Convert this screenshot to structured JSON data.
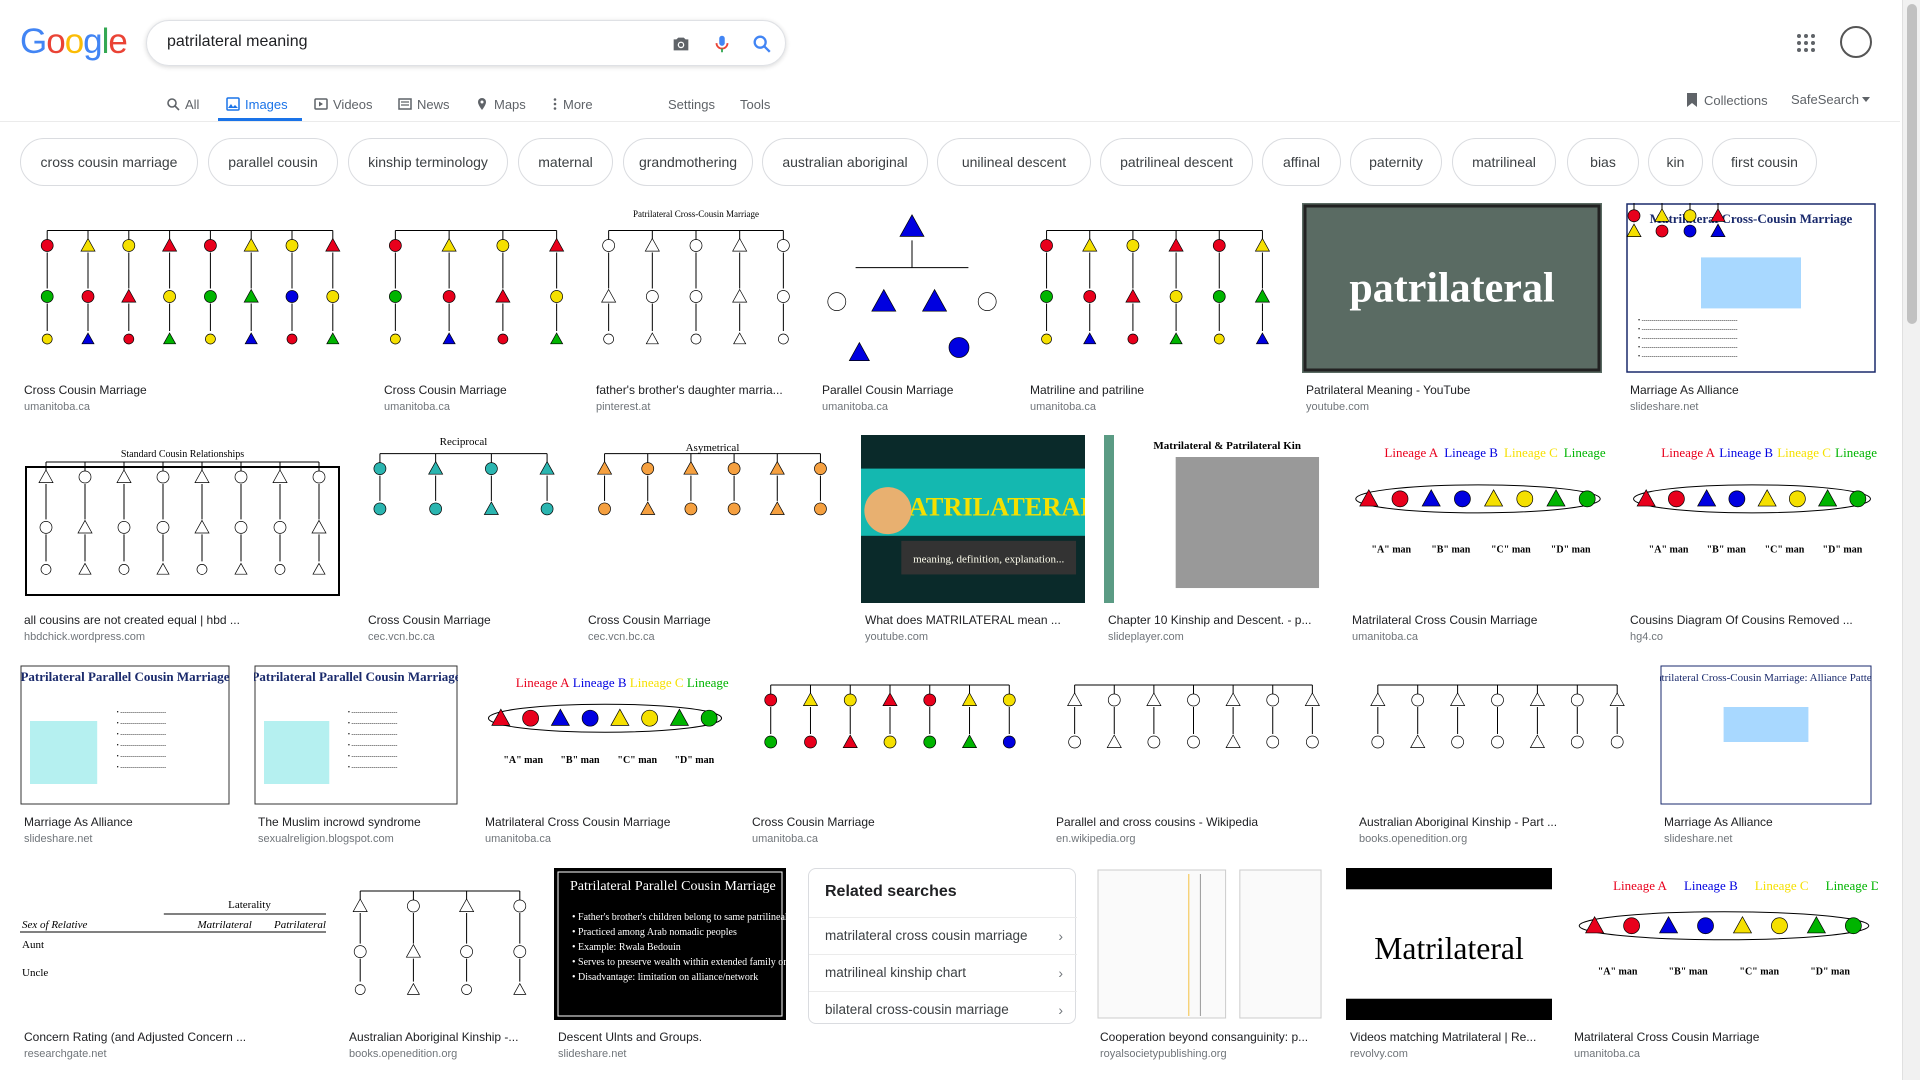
{
  "logo": {
    "letters": [
      "G",
      "o",
      "o",
      "g",
      "l",
      "e"
    ],
    "colors": [
      "#4285f4",
      "#ea4335",
      "#fbbc05",
      "#4285f4",
      "#34a853",
      "#ea4335"
    ]
  },
  "search": {
    "query": "patrilateral meaning"
  },
  "nav": {
    "tabs": [
      {
        "label": "All",
        "icon": "search-icon"
      },
      {
        "label": "Images",
        "icon": "image-icon"
      },
      {
        "label": "Videos",
        "icon": "play-icon"
      },
      {
        "label": "News",
        "icon": "news-icon"
      },
      {
        "label": "Maps",
        "icon": "map-pin-icon"
      },
      {
        "label": "More",
        "icon": "more-vert-icon"
      }
    ],
    "settings": "Settings",
    "tools": "Tools",
    "collections": "Collections",
    "safesearch": "SafeSearch"
  },
  "chips": [
    "cross cousin marriage",
    "parallel cousin",
    "kinship terminology",
    "maternal",
    "grandmothering",
    "australian aboriginal",
    "unilineal descent",
    "patrilineal descent",
    "affinal",
    "paternity",
    "matrilineal",
    "bias",
    "kin",
    "first cousin"
  ],
  "results": [
    {
      "title": "Cross Cousin Marriage",
      "source": "umanitoba.ca"
    },
    {
      "title": "Cross Cousin Marriage",
      "source": "umanitoba.ca"
    },
    {
      "title": "father's brother's daughter marria...",
      "source": "pinterest.at"
    },
    {
      "title": "Parallel Cousin Marriage",
      "source": "umanitoba.ca"
    },
    {
      "title": "Matriline and patriline",
      "source": "umanitoba.ca"
    },
    {
      "title": "Patrilateral Meaning - YouTube",
      "source": "youtube.com"
    },
    {
      "title": "Marriage As Alliance",
      "source": "slideshare.net"
    },
    {
      "title": "all cousins are not created equal | hbd ...",
      "source": "hbdchick.wordpress.com"
    },
    {
      "title": "Cross Cousin Marriage",
      "source": "cec.vcn.bc.ca"
    },
    {
      "title": "Cross Cousin Marriage",
      "source": "cec.vcn.bc.ca"
    },
    {
      "title": "What does MATRILATERAL mean ...",
      "source": "youtube.com"
    },
    {
      "title": "Chapter 10 Kinship and Descent. - p...",
      "source": "slideplayer.com"
    },
    {
      "title": "Matrilateral Cross Cousin Marriage",
      "source": "umanitoba.ca"
    },
    {
      "title": "Cousins Diagram Of Cousins Removed ...",
      "source": "hg4.co"
    },
    {
      "title": "Marriage As Alliance",
      "source": "slideshare.net"
    },
    {
      "title": "The Muslim incrowd syndrome",
      "source": "sexualreligion.blogspot.com"
    },
    {
      "title": "Matrilateral Cross Cousin Marriage",
      "source": "umanitoba.ca"
    },
    {
      "title": "Cross Cousin Marriage",
      "source": "umanitoba.ca"
    },
    {
      "title": "Parallel and cross cousins - Wikipedia",
      "source": "en.wikipedia.org"
    },
    {
      "title": "Australian Aboriginal Kinship - Part ...",
      "source": "books.openedition.org"
    },
    {
      "title": "Marriage As Alliance",
      "source": "slideshare.net"
    },
    {
      "title": "Concern Rating (and Adjusted Concern ...",
      "source": "researchgate.net"
    },
    {
      "title": "Australian Aboriginal Kinship -...",
      "source": "books.openedition.org"
    },
    {
      "title": "Descent Ulnts and Groups.",
      "source": "slideshare.net"
    },
    {
      "title": "Cooperation beyond consanguinity: p...",
      "source": "royalsocietypublishing.org"
    },
    {
      "title": "Videos matching Matrilateral | Re...",
      "source": "revolvy.com"
    },
    {
      "title": "Matrilateral Cross Cousin Marriage",
      "source": "umanitoba.ca"
    }
  ],
  "thumb_text": {
    "patrilateral": "patrilateral",
    "matrilateral_banner": "MATRILATERAL",
    "matrilateral_sub": "meaning, definition, explanation...",
    "matrilateral_word": "Matrilateral",
    "marriage_alliance_title": "Matrilateral Cross-Cousin Marriage",
    "patrilateral_parallel_title": "Patrilateral Parallel Cousin Marriage",
    "chapter10_title": "Matrilateral & Patrilateral Kin",
    "standard_title": "Standard Cousin Relationships",
    "reciprocal": "Reciprocal",
    "asymetrical": "Asymetrical",
    "alliance_patterns": "Matrilateral Cross-Cousin Marriage: Alliance Patterns",
    "laterality": "Laterality",
    "sex_of_relative": "Sex of Relative",
    "matrilateral_col": "Matrilateral",
    "patrilateral_col": "Patrilateral",
    "aunt": "Aunt",
    "uncle": "Uncle",
    "descent_bullets": [
      "Father's brother's children belong to same patrilineal descent unit",
      "Practiced among Arab nomadic peoples",
      "Example: Rwala Bedouin",
      "Serves to preserve wealth within extended family or lineage",
      "Disadvantage: limitation on alliance/network"
    ],
    "lineages": [
      "Lineage A",
      "Lineage B",
      "Lineage C",
      "Lineage D"
    ]
  },
  "related": {
    "heading": "Related searches",
    "items": [
      "matrilateral cross cousin marriage",
      "matrilineal kinship chart",
      "bilateral cross-cousin marriage"
    ]
  },
  "colors": {
    "accent": "#1a73e8",
    "red": "#e8001c",
    "blue": "#0000e0",
    "yellow": "#f5e000",
    "green": "#00b400",
    "dark_slide": "#5a6b63"
  }
}
